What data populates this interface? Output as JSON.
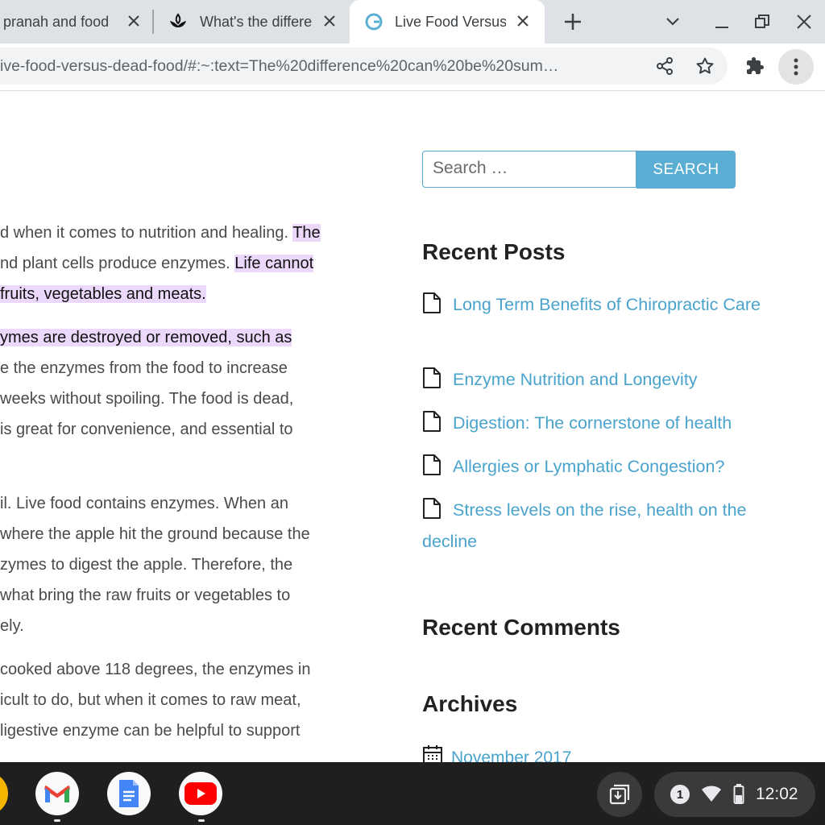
{
  "tabs": [
    {
      "title": "pranah and food",
      "active": false
    },
    {
      "title": "What's the differe",
      "active": false
    },
    {
      "title": "Live Food Versus",
      "active": true
    }
  ],
  "toolbar": {
    "url": "ive-food-versus-dead-food/#:~:text=The%20difference%20can%20be%20sum…"
  },
  "article": {
    "lines": [
      {
        "segments": [
          {
            "text": "d when it comes to nutrition and healing. ",
            "hl": false
          },
          {
            "text": "The",
            "hl": true
          }
        ]
      },
      {
        "segments": [
          {
            "text": "nd plant cells produce enzymes. ",
            "hl": false
          },
          {
            "text": "Life cannot",
            "hl": true
          }
        ]
      },
      {
        "segments": [
          {
            "text": "fruits, vegetables and meats.",
            "hl": true
          }
        ]
      },
      {
        "segments": [
          {
            "text": "ymes are destroyed or removed, such as",
            "hl": true
          }
        ]
      },
      {
        "segments": [
          {
            "text": "e the enzymes from the food to increase",
            "hl": false
          }
        ]
      },
      {
        "segments": [
          {
            "text": " weeks without spoiling. The food is dead,",
            "hl": false
          }
        ]
      },
      {
        "segments": [
          {
            "text": " is great for convenience, and essential to",
            "hl": false
          }
        ]
      },
      {
        "segments": [
          {
            "text": "il. Live food contains enzymes. When an",
            "hl": false
          }
        ]
      },
      {
        "segments": [
          {
            "text": "where the apple hit the ground because the",
            "hl": false
          }
        ]
      },
      {
        "segments": [
          {
            "text": "zymes to digest the apple. Therefore, the",
            "hl": false
          }
        ]
      },
      {
        "segments": [
          {
            "text": " what bring the raw fruits or vegetables to",
            "hl": false
          }
        ]
      },
      {
        "segments": [
          {
            "text": "ely.",
            "hl": false
          }
        ]
      },
      {
        "segments": [
          {
            "text": " cooked above 118 degrees, the enzymes in",
            "hl": false
          }
        ]
      },
      {
        "segments": [
          {
            "text": "icult to do, but when it comes to raw meat,",
            "hl": false
          }
        ]
      },
      {
        "segments": [
          {
            "text": "ligestive enzyme can be helpful to support",
            "hl": false
          }
        ]
      }
    ]
  },
  "sidebar": {
    "search_placeholder": "Search …",
    "search_button": "SEARCH",
    "recent_posts_title": "Recent Posts",
    "posts": [
      {
        "title": "Long Term Benefits of Chiropractic Care"
      },
      {
        "title": "Enzyme Nutrition and Longevity"
      },
      {
        "title": "Digestion: The cornerstone of health"
      },
      {
        "title": "Allergies or Lymphatic Congestion?"
      },
      {
        "title": "Stress levels on the rise, health on the decline"
      }
    ],
    "recent_comments_title": "Recent Comments",
    "archives_title": "Archives",
    "archives": [
      {
        "label": "November 2017"
      }
    ]
  },
  "shelf": {
    "apps": [
      {
        "icon": "chrome-icon"
      },
      {
        "icon": "gmail-icon"
      },
      {
        "icon": "google-docs-icon"
      },
      {
        "icon": "youtube-icon"
      }
    ],
    "notification_count": "1",
    "time": "12:02"
  },
  "colors": {
    "link": "#4aa3cc",
    "highlight": "#ecd8fb",
    "search_button": "#5aaed3",
    "tab_strip": "#dee1e6",
    "shelf": "#1f1f1f"
  }
}
